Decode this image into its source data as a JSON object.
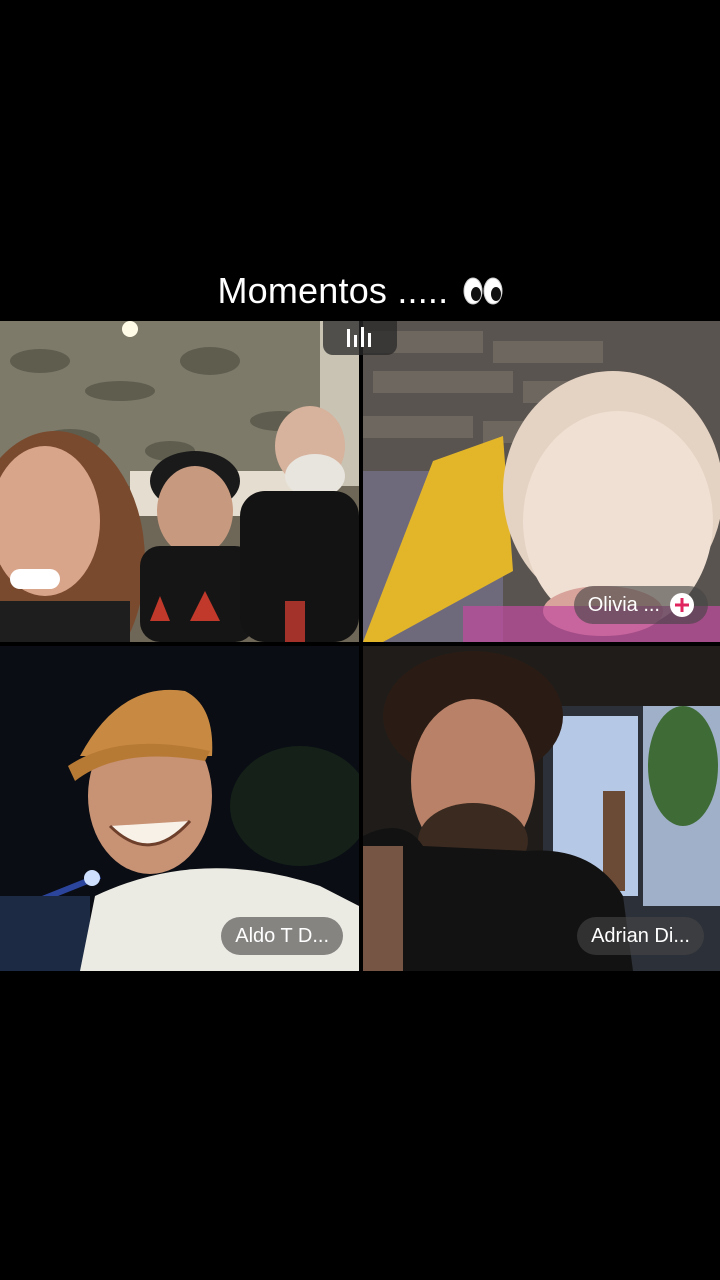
{
  "caption": {
    "text": "Momentos .....",
    "emoji": "eyes-emoji"
  },
  "live_indicator": {
    "icon": "audio-bars-icon"
  },
  "participants": [
    {
      "id": "tile-top-left",
      "name": ""
    },
    {
      "id": "tile-top-right",
      "name": "Olivia ...",
      "action_icon": "add-icon",
      "accent": "#e0245e"
    },
    {
      "id": "tile-bottom-left",
      "name": "Aldo T D..."
    },
    {
      "id": "tile-bottom-right",
      "name": "Adrian Di..."
    }
  ]
}
